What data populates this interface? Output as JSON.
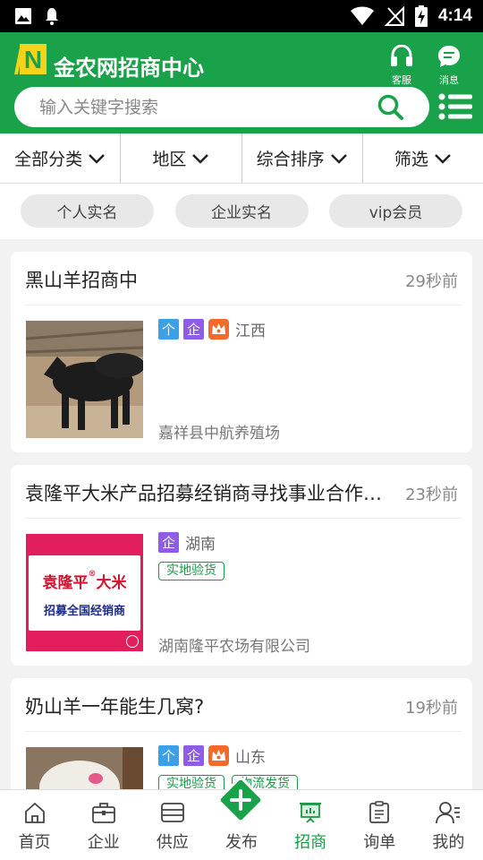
{
  "status_bar": {
    "time": "4:14"
  },
  "header": {
    "logo_letter": "N",
    "title": "金农网招商中心",
    "service_label": "客服",
    "message_label": "消息"
  },
  "search": {
    "placeholder": "输入关键字搜索",
    "value": ""
  },
  "filters": [
    {
      "label": "全部分类"
    },
    {
      "label": "地区"
    },
    {
      "label": "综合排序"
    },
    {
      "label": "筛选"
    }
  ],
  "chips": [
    {
      "label": "个人实名"
    },
    {
      "label": "企业实名"
    },
    {
      "label": "vip会员"
    }
  ],
  "listings": [
    {
      "title": "黑山羊招商中",
      "time": "29秒前",
      "badge_personal": "个",
      "badge_company": "企",
      "region": "江西",
      "tags": [],
      "company": "嘉祥县中航养殖场"
    },
    {
      "title": "袁隆平大米产品招募经销商寻找事业合作伙伴",
      "time": "23秒前",
      "badge_company": "企",
      "region": "湖南",
      "tags": [
        "实地验货"
      ],
      "company": "湖南隆平农场有限公司",
      "thumb_line1": "袁隆平",
      "thumb_mark": "®",
      "thumb_line1b": "大米",
      "thumb_line2": "招募全国经销商"
    },
    {
      "title": "奶山羊一年能生几窝?",
      "time": "19秒前",
      "badge_personal": "个",
      "badge_company": "企",
      "region": "山东",
      "tags": [
        "实地验货",
        "物流发货"
      ]
    }
  ],
  "bottom_nav": [
    {
      "label": "首页",
      "icon": "home-icon"
    },
    {
      "label": "企业",
      "icon": "briefcase-icon"
    },
    {
      "label": "供应",
      "icon": "supply-box-icon"
    },
    {
      "label": "发布",
      "icon": "plus-icon"
    },
    {
      "label": "招商",
      "icon": "presentation-icon",
      "active": true
    },
    {
      "label": "询单",
      "icon": "clipboard-icon"
    },
    {
      "label": "我的",
      "icon": "user-icon"
    }
  ],
  "colors": {
    "brand_green": "#1aa24a",
    "badge_personal": "#3aa0e8",
    "badge_company": "#8e5ce6",
    "badge_vip": "#f36a2c"
  }
}
